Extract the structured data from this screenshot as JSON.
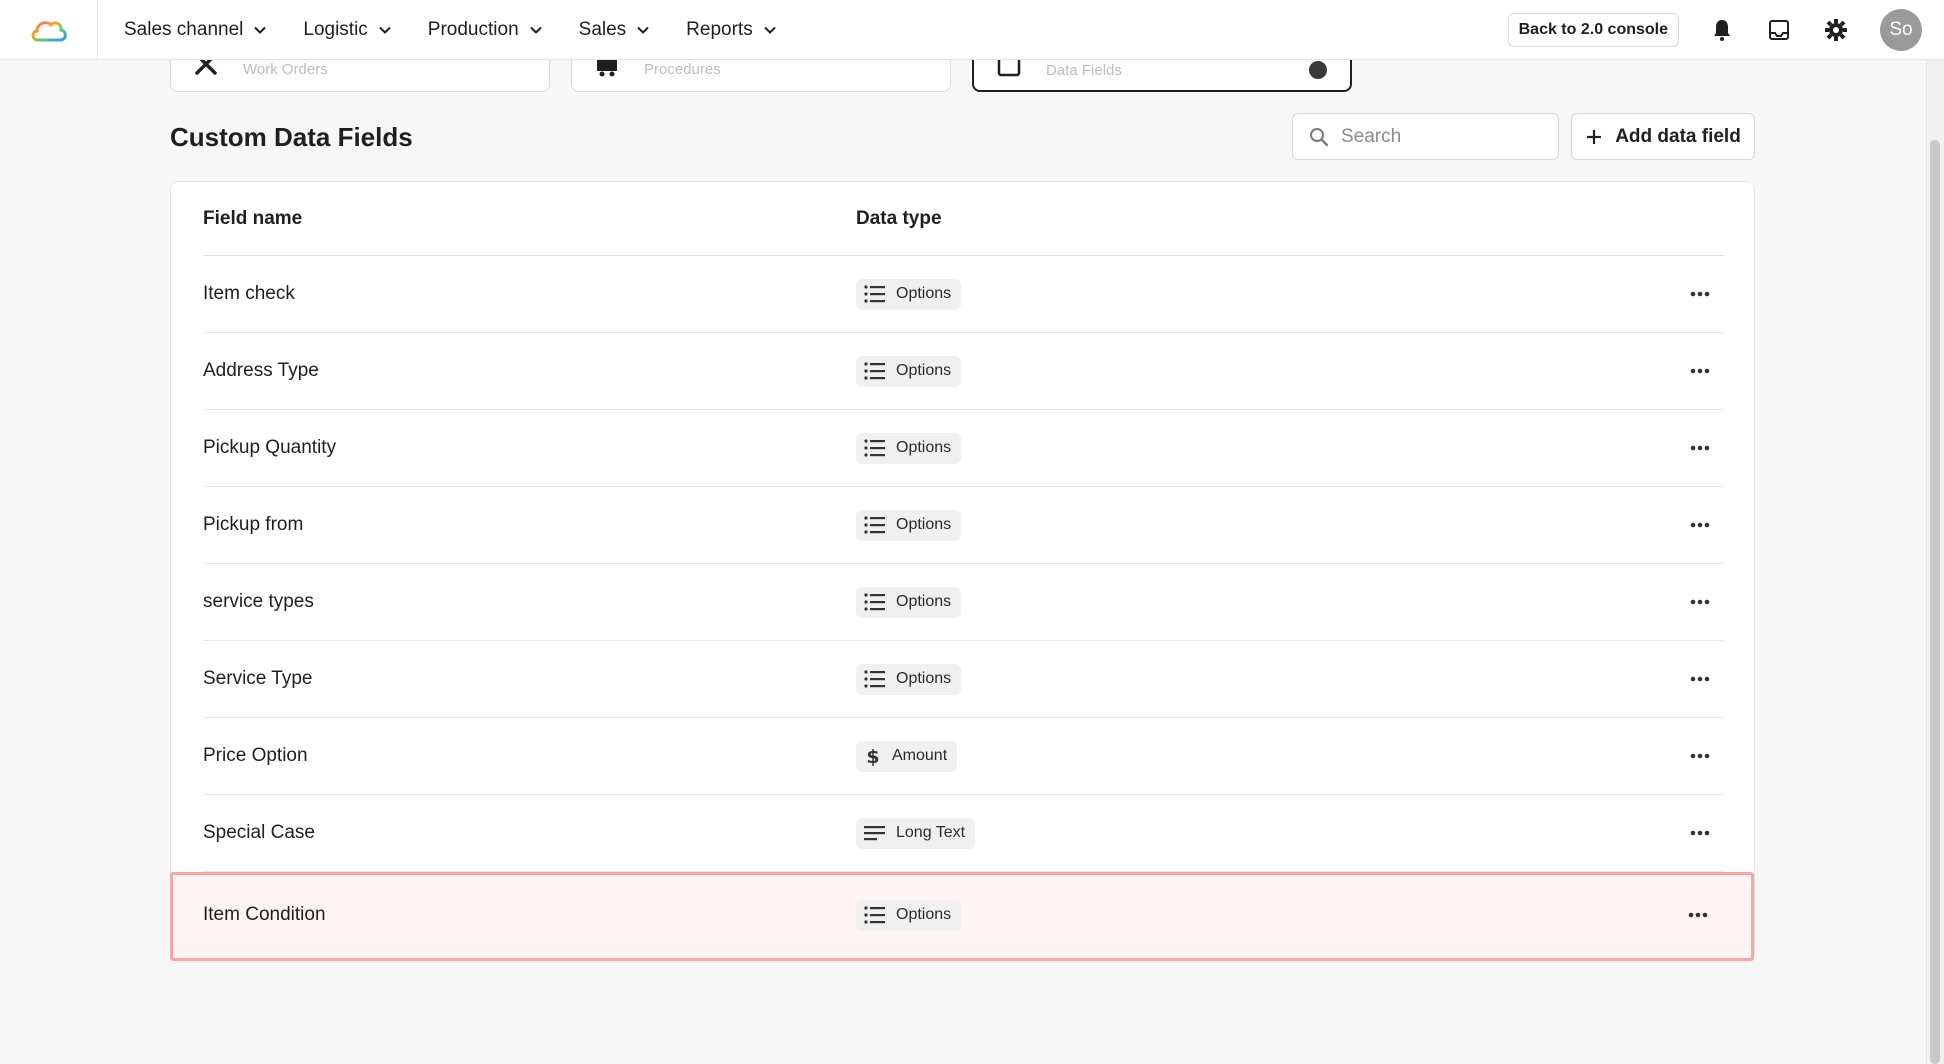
{
  "nav": {
    "items": [
      {
        "label": "Sales channel"
      },
      {
        "label": "Logistic"
      },
      {
        "label": "Production"
      },
      {
        "label": "Sales"
      },
      {
        "label": "Reports"
      }
    ],
    "back_button": "Back to 2.0 console",
    "avatar_initials": "So"
  },
  "tiles": [
    {
      "label": "Work Orders",
      "icon": "tools-icon"
    },
    {
      "label": "Procedures",
      "icon": "cart-icon"
    },
    {
      "label": "Data Fields",
      "icon": "calendar-icon"
    }
  ],
  "page": {
    "title": "Custom Data Fields",
    "search_placeholder": "Search",
    "add_button": "Add data field"
  },
  "table": {
    "headers": {
      "name": "Field name",
      "type": "Data type"
    },
    "rows": [
      {
        "name": "Item check",
        "type": "Options",
        "icon": "list-icon"
      },
      {
        "name": "Address Type",
        "type": "Options",
        "icon": "list-icon"
      },
      {
        "name": "Pickup Quantity",
        "type": "Options",
        "icon": "list-icon"
      },
      {
        "name": "Pickup from",
        "type": "Options",
        "icon": "list-icon"
      },
      {
        "name": "service types",
        "type": "Options",
        "icon": "list-icon"
      },
      {
        "name": "Service Type",
        "type": "Options",
        "icon": "list-icon"
      },
      {
        "name": "Price Option",
        "type": "Amount",
        "icon": "dollar-icon"
      },
      {
        "name": "Special Case",
        "type": "Long Text",
        "icon": "text-lines-icon"
      },
      {
        "name": "Item Condition",
        "type": "Options",
        "icon": "list-icon"
      }
    ]
  },
  "colors": {
    "highlight_border": "#f3a8a8",
    "highlight_bg": "#fdf4f3",
    "pill_bg": "#f0f0f0"
  }
}
